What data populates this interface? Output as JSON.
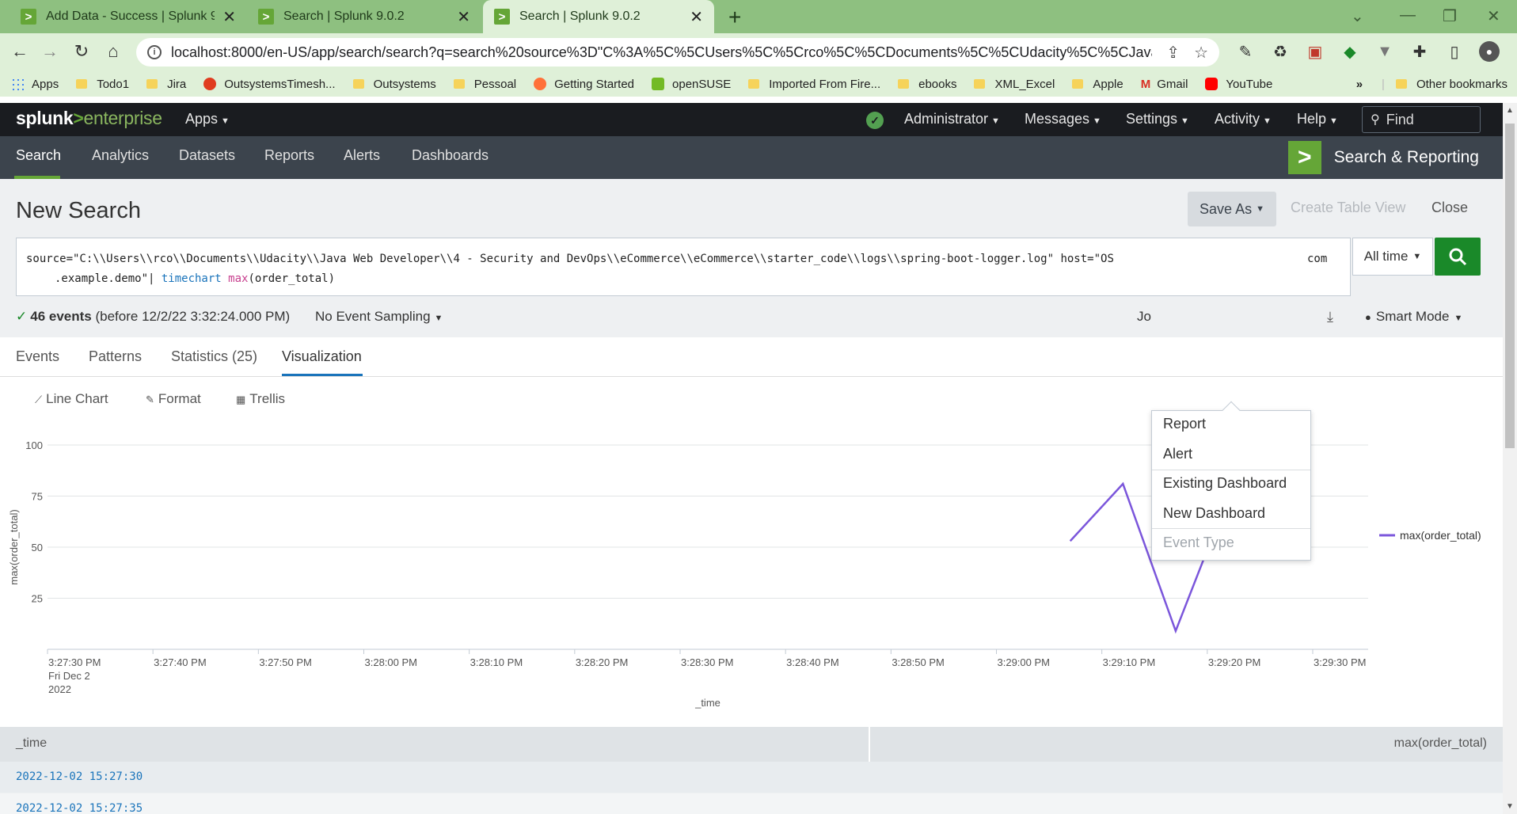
{
  "browser": {
    "tabs": [
      {
        "title": "Add Data - Success | Splunk 9.0.2"
      },
      {
        "title": "Search | Splunk 9.0.2"
      },
      {
        "title": "Search | Splunk 9.0.2"
      }
    ],
    "url": "localhost:8000/en-US/app/search/search?q=search%20source%3D\"C%3A%5C%5CUsers%5C%5Crco%5C%5CDocuments%5C%5CUdacity%5C%5CJava%20Web...",
    "bookmarks": [
      "Apps",
      "Todo1",
      "Jira",
      "OutsystemsTimesh...",
      "Outsystems",
      "Pessoal",
      "Getting Started",
      "openSUSE",
      "Imported From Fire...",
      "ebooks",
      "XML_Excel",
      "Apple",
      "Gmail",
      "YouTube"
    ],
    "other_bookmarks": "Other bookmarks",
    "more": "»"
  },
  "splunk": {
    "logo": {
      "a": "splunk",
      "b": ">",
      "c": "enterprise"
    },
    "topnav": {
      "apps": "Apps",
      "admin": "Administrator",
      "messages": "Messages",
      "settings": "Settings",
      "activity": "Activity",
      "help": "Help",
      "find": "Find"
    },
    "appnav": {
      "search": "Search",
      "analytics": "Analytics",
      "datasets": "Datasets",
      "reports": "Reports",
      "alerts": "Alerts",
      "dashboards": "Dashboards"
    },
    "app_title": "Search & Reporting"
  },
  "search": {
    "page_title": "New Search",
    "save_as": "Save As",
    "create_table_view": "Create Table View",
    "close": "Close",
    "query_line1": "source=\"C:\\\\Users\\\\rco\\\\Documents\\\\Udacity\\\\Java Web Developer\\\\4 - Security and DevOps\\\\eCommerce\\\\eCommerce\\\\starter_code\\\\logs\\\\spring-boot-logger.log\" host=\"OS",
    "query_line1_end": "com",
    "query_line2_pre": ".example.demo\"| ",
    "query_cmd": "timechart",
    "query_fn": "max",
    "query_arg": "(order_total)",
    "time_range": "All time",
    "events_count": "46 events",
    "events_detail": "(before 12/2/22 3:32:24.000 PM)",
    "sampling": "No Event Sampling",
    "job": "Jo",
    "mode": "Smart Mode"
  },
  "result_tabs": {
    "events": "Events",
    "patterns": "Patterns",
    "statistics": "Statistics (25)",
    "visualization": "Visualization"
  },
  "viz_controls": {
    "line_chart": "Line Chart",
    "format": "Format",
    "trellis": "Trellis"
  },
  "save_menu": {
    "report": "Report",
    "alert": "Alert",
    "existing_dashboard": "Existing Dashboard",
    "new_dashboard": "New Dashboard",
    "event_type": "Event Type"
  },
  "chart_data": {
    "type": "line",
    "xlabel": "_time",
    "ylabel": "max(order_total)",
    "ylim": [
      0,
      100
    ],
    "yticks": [
      25,
      50,
      75,
      100
    ],
    "x_ticks": [
      "3:27:30 PM",
      "3:27:40 PM",
      "3:27:50 PM",
      "3:28:00 PM",
      "3:28:10 PM",
      "3:28:20 PM",
      "3:28:30 PM",
      "3:28:40 PM",
      "3:28:50 PM",
      "3:29:00 PM",
      "3:29:10 PM",
      "3:29:20 PM",
      "3:29:30 PM"
    ],
    "x_first_sub": [
      "Fri Dec 2",
      "2022"
    ],
    "x": [
      "3:29:07 PM",
      "3:29:12 PM",
      "3:29:17 PM",
      "3:29:22 PM",
      "3:29:27 PM",
      "3:29:32 PM"
    ],
    "series": [
      {
        "name": "max(order_total)",
        "values": [
          53,
          81,
          9,
          75,
          53,
          null
        ],
        "color": "#7b56db"
      }
    ],
    "legend": "right"
  },
  "table": {
    "headers": [
      "_time",
      "max(order_total)"
    ],
    "rows": [
      "2022-12-02 15:27:30",
      "2022-12-02 15:27:35"
    ]
  }
}
